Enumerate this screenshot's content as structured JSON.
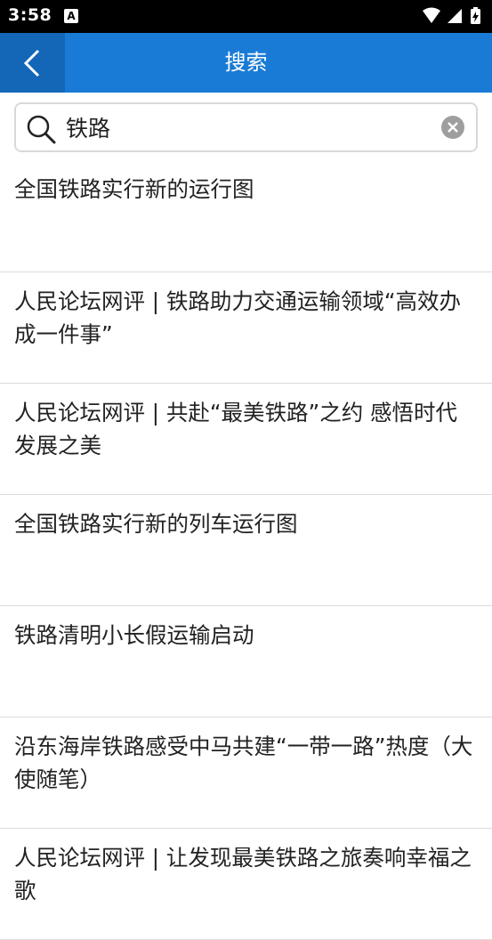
{
  "status_bar": {
    "time": "3:58",
    "notification_icon_letter": "A",
    "icons": [
      "wifi-icon",
      "signal-icon",
      "battery-charging-icon"
    ]
  },
  "app_bar": {
    "title": "搜索",
    "background_color": "#1a7bd6",
    "back_button_color": "#1466b7"
  },
  "search": {
    "value": "铁路",
    "placeholder": ""
  },
  "results": [
    {
      "title": "全国铁路实行新的运行图"
    },
    {
      "title": "人民论坛网评 | 铁路助力交通运输领域“高效办成一件事”"
    },
    {
      "title": "人民论坛网评 | 共赴“最美铁路”之约 感悟时代发展之美"
    },
    {
      "title": "全国铁路实行新的列车运行图"
    },
    {
      "title": "铁路清明小长假运输启动"
    },
    {
      "title": "沿东海岸铁路感受中马共建“一带一路”热度（大使随笔）"
    },
    {
      "title": "人民论坛网评 | 让发现最美铁路之旅奏响幸福之歌"
    }
  ]
}
